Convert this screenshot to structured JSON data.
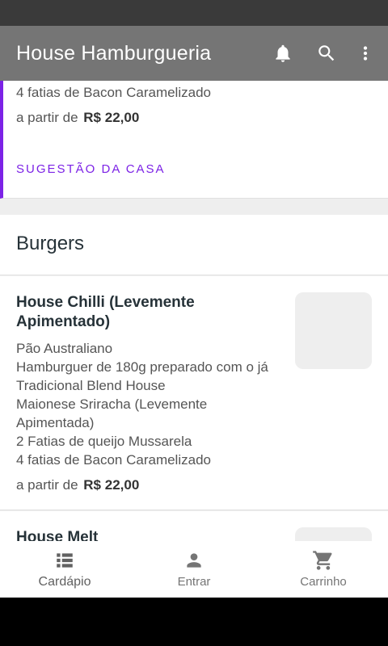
{
  "app_bar": {
    "title": "House Hamburgueria",
    "icons": [
      "bell-icon",
      "search-icon",
      "more-vert-icon"
    ]
  },
  "suggestion": {
    "description_line": "4 fatias de Bacon Caramelizado",
    "price_prefix": "a partir de",
    "price": "R$ 22,00",
    "tag": "SUGESTÃO DA CASA",
    "accent_color": "#7c22e6"
  },
  "section": {
    "title": "Burgers"
  },
  "products": [
    {
      "name": "House Chilli (Levemente Apimentado)",
      "description_lines": [
        "Pão Australiano",
        "Hamburguer de 180g preparado com o já",
        "Tradicional Blend House",
        "Maionese Sriracha (Levemente",
        "Apimentada)",
        "2 Fatias de queijo Mussarela",
        "4 fatias de Bacon Caramelizado"
      ],
      "price_prefix": "a partir de",
      "price": "R$ 22,00"
    },
    {
      "name": "House Melt"
    }
  ],
  "bottom_nav": {
    "items": [
      {
        "label": "Cardápio",
        "icon": "menu-list-icon",
        "active": true
      },
      {
        "label": "Entrar",
        "icon": "person-icon",
        "active": false
      },
      {
        "label": "Carrinho",
        "icon": "cart-icon",
        "active": false
      }
    ]
  }
}
